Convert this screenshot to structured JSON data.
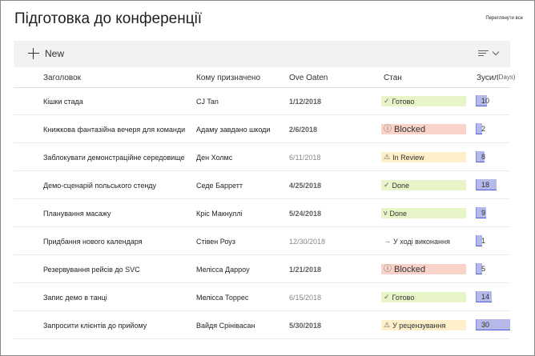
{
  "header": {
    "title": "Підготовка до конференції",
    "see_all": "Переглянути все"
  },
  "commandbar": {
    "new_label": "New",
    "view_icon": "view-options-icon",
    "chevron_icon": "chevron-down-icon"
  },
  "columns": {
    "title": "Заголовок",
    "assigned": "Кому призначено",
    "date": "Ove Oaten",
    "status": "Стан",
    "effort": "Зусил",
    "effort_unit": "(Days)"
  },
  "colors": {
    "done_pill": "#e8f5c8",
    "blocked_pill": "#f9d2c9",
    "review_pill": "#fcefc9",
    "bar_fill": "#b4b9e8",
    "bar_edge": "#4f5bd5"
  },
  "effort_max": 30,
  "rows": [
    {
      "title": "Кішки стада",
      "assigned": "CJ Tan",
      "date": "1/12/2018",
      "date_style": "bold",
      "status_icon": "✓",
      "status_icon_name": "check-icon",
      "status": "Готово",
      "status_kind": "done",
      "effort": 10
    },
    {
      "title": "Книжкова фантазійна вечеря для команди",
      "assigned": "Адаму завдано шкоди",
      "date": "2/6/2018",
      "date_style": "bold",
      "status_icon": "ⓘ",
      "status_icon_name": "blocked-icon",
      "status": "Blocked",
      "status_kind": "blocked",
      "effort": 2
    },
    {
      "title": "Заблокувати демонстраційне середовище",
      "assigned": "Ден Холмс",
      "date": "6/11/2018",
      "date_style": "light",
      "status_icon": "⚠",
      "status_icon_name": "warning-icon",
      "status": "In Review",
      "status_kind": "review",
      "effort": 8
    },
    {
      "title": "Демо-сценарій польського стенду",
      "assigned": "Седе Барретт",
      "date": "4/25/2018",
      "date_style": "bold",
      "status_icon": "✓",
      "status_icon_name": "check-icon",
      "status": "Done",
      "status_kind": "done",
      "effort": 18
    },
    {
      "title": "Планування масажу",
      "assigned": "Кріс Макнуллі",
      "date": "5/24/2018",
      "date_style": "bold",
      "status_icon": "v",
      "status_icon_name": "check-icon",
      "status": "Done",
      "status_kind": "done",
      "effort": 9
    },
    {
      "title": "Придбання нового календаря",
      "assigned": "Стівен Роуз",
      "date": "12/30/2018",
      "date_style": "light",
      "status_icon": "→",
      "status_icon_name": "arrow-right-icon",
      "status": "У ході виконання",
      "status_kind": "progress",
      "effort": 1
    },
    {
      "title": "Резервування рейсів до SVC",
      "assigned": "Мелісса Даррoу",
      "date": "1/21/2018",
      "date_style": "bold",
      "status_icon": "ⓘ",
      "status_icon_name": "blocked-icon",
      "status": "Blocked",
      "status_kind": "blocked",
      "effort": 5
    },
    {
      "title": "Запис демо в танці",
      "assigned": "Мелісса Торрес",
      "date": "6/15/2018",
      "date_style": "light",
      "status_icon": "✓",
      "status_icon_name": "check-icon",
      "status": "Готово",
      "status_kind": "done",
      "effort": 14
    },
    {
      "title": "Запросити клієнтів до прийому",
      "assigned": "Вайдя Срінівасан",
      "date": "5/30/2018",
      "date_style": "bold",
      "status_icon": "⚠",
      "status_icon_name": "warning-icon",
      "status": "У рецензування",
      "status_kind": "review",
      "effort": 30
    }
  ]
}
